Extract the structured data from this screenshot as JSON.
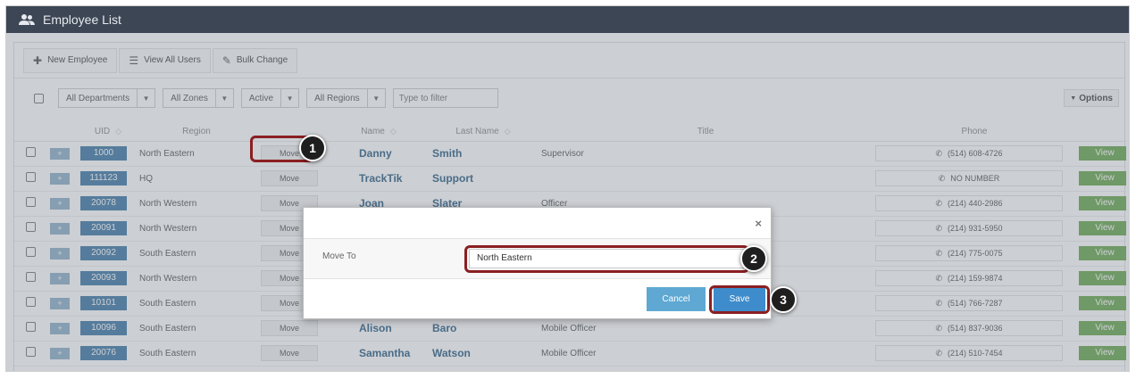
{
  "window": {
    "title": "Employee List"
  },
  "toolbar": {
    "new_employee": "New Employee",
    "view_all_users": "View All Users",
    "bulk_change": "Bulk Change"
  },
  "filters": {
    "departments": "All Departments",
    "zones": "All Zones",
    "status": "Active",
    "regions": "All Regions",
    "search_placeholder": "Type to filter",
    "options": "Options"
  },
  "columns": {
    "uid": "UID",
    "region": "Region",
    "name": "Name",
    "last_name": "Last Name",
    "title": "Title",
    "phone": "Phone"
  },
  "row_labels": {
    "plus": "+",
    "move": "Move",
    "view": "View"
  },
  "rows": [
    {
      "uid": "1000",
      "region": "North Eastern",
      "name": "Danny",
      "last_name": "Smith",
      "title": "Supervisor",
      "phone": "(514) 608-4726"
    },
    {
      "uid": "111123",
      "region": "HQ",
      "name": "TrackTik",
      "last_name": "Support",
      "title": "",
      "phone": "NO NUMBER"
    },
    {
      "uid": "20078",
      "region": "North Western",
      "name": "Joan",
      "last_name": "Slater",
      "title": "Officer",
      "phone": "(214) 440-2986"
    },
    {
      "uid": "20091",
      "region": "North Western",
      "name": "",
      "last_name": "",
      "title": "",
      "phone": "(214) 931-5950"
    },
    {
      "uid": "20092",
      "region": "South Eastern",
      "name": "",
      "last_name": "",
      "title": "",
      "phone": "(214) 775-0075"
    },
    {
      "uid": "20093",
      "region": "North Western",
      "name": "",
      "last_name": "",
      "title": "",
      "phone": "(214) 159-9874"
    },
    {
      "uid": "10101",
      "region": "South Eastern",
      "name": "",
      "last_name": "",
      "title": "",
      "phone": "(514) 766-7287"
    },
    {
      "uid": "10096",
      "region": "South Eastern",
      "name": "Alison",
      "last_name": "Baro",
      "title": "Mobile Officer",
      "phone": "(514) 837-9036"
    },
    {
      "uid": "20076",
      "region": "South Eastern",
      "name": "Samantha",
      "last_name": "Watson",
      "title": "Mobile Officer",
      "phone": "(214) 510-7454"
    }
  ],
  "modal": {
    "close": "×",
    "move_to_label": "Move To",
    "move_to_value": "North Eastern",
    "cancel": "Cancel",
    "save": "Save"
  },
  "callouts": {
    "one": "1",
    "two": "2",
    "three": "3"
  }
}
